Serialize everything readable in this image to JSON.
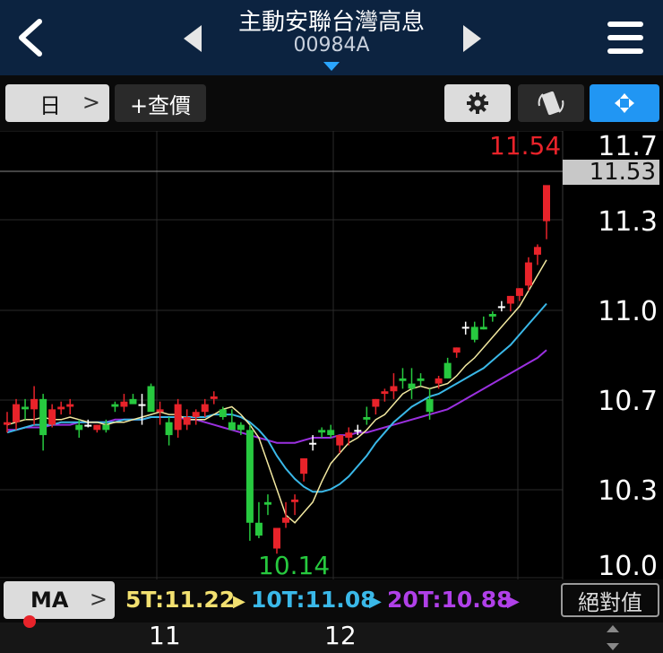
{
  "header": {
    "title": "主動安聯台灣高息",
    "code": "00984A",
    "colors": {
      "bg": "#0c2340",
      "accent": "#2aa6ff"
    }
  },
  "toolbar": {
    "period_label": "日",
    "quote_label": "+查價",
    "icons": [
      "chevron-right-icon",
      "gear-icon",
      "rotate-icon",
      "fullscreen-icon"
    ]
  },
  "chart": {
    "y_ticks": [
      "11.7",
      "11.53",
      "11.3",
      "11.0",
      "10.7",
      "10.3",
      "10.0"
    ],
    "current_price": "11.53",
    "high_label": "11.54",
    "low_label": "10.14",
    "x_ticks": [
      "11",
      "12"
    ]
  },
  "ma_bar": {
    "ma_label": "MA",
    "ma5": "5T:11.22",
    "ma10": "10T:11.08",
    "ma20": "20T:10.88",
    "abs_label": "絕對值"
  },
  "chart_data": {
    "type": "candlestick",
    "up_color": "#e8232a",
    "down_color": "#27c93f",
    "ylim": [
      10.0,
      11.74
    ],
    "candles": [
      [
        10.6,
        10.65,
        10.57,
        10.61
      ],
      [
        10.61,
        10.7,
        10.58,
        10.68
      ],
      [
        10.67,
        10.7,
        10.62,
        10.66
      ],
      [
        10.66,
        10.75,
        10.6,
        10.7
      ],
      [
        10.7,
        10.72,
        10.5,
        10.56
      ],
      [
        10.6,
        10.68,
        10.59,
        10.66
      ],
      [
        10.66,
        10.69,
        10.64,
        10.67
      ],
      [
        10.67,
        10.7,
        10.64,
        10.68
      ],
      [
        10.6,
        10.62,
        10.55,
        10.58
      ],
      [
        10.6,
        10.62,
        10.59,
        10.6
      ],
      [
        10.58,
        10.6,
        10.57,
        10.6
      ],
      [
        10.6,
        10.62,
        10.57,
        10.58
      ],
      [
        10.68,
        10.69,
        10.65,
        10.67
      ],
      [
        10.67,
        10.72,
        10.65,
        10.69
      ],
      [
        10.7,
        10.72,
        10.69,
        10.68
      ],
      [
        10.68,
        10.72,
        10.6,
        10.68
      ],
      [
        10.75,
        10.76,
        10.68,
        10.65
      ],
      [
        10.65,
        10.69,
        10.6,
        10.66
      ],
      [
        10.61,
        10.63,
        10.52,
        10.56
      ],
      [
        10.58,
        10.7,
        10.55,
        10.68
      ],
      [
        10.6,
        10.66,
        10.58,
        10.63
      ],
      [
        10.63,
        10.66,
        10.6,
        10.65
      ],
      [
        10.65,
        10.7,
        10.63,
        10.68
      ],
      [
        10.7,
        10.73,
        10.68,
        10.71
      ],
      [
        10.66,
        10.67,
        10.62,
        10.63
      ],
      [
        10.61,
        10.66,
        10.58,
        10.58
      ],
      [
        10.6,
        10.61,
        10.56,
        10.58
      ],
      [
        10.58,
        10.6,
        10.15,
        10.22
      ],
      [
        10.22,
        10.3,
        10.16,
        10.17
      ],
      [
        10.3,
        10.33,
        10.25,
        10.29
      ],
      [
        10.12,
        10.19,
        10.1,
        10.2
      ],
      [
        10.22,
        10.3,
        10.2,
        10.24
      ],
      [
        10.3,
        10.33,
        10.25,
        10.31
      ],
      [
        10.41,
        10.47,
        10.38,
        10.47
      ],
      [
        10.53,
        10.56,
        10.5,
        10.53
      ],
      [
        10.58,
        10.59,
        10.55,
        10.57
      ],
      [
        10.58,
        10.6,
        10.55,
        10.56
      ],
      [
        10.52,
        10.56,
        10.49,
        10.56
      ],
      [
        10.55,
        10.59,
        10.52,
        10.57
      ],
      [
        10.58,
        10.6,
        10.56,
        10.58
      ],
      [
        10.63,
        10.67,
        10.6,
        10.62
      ],
      [
        10.67,
        10.7,
        10.64,
        10.7
      ],
      [
        10.72,
        10.74,
        10.69,
        10.73
      ],
      [
        10.73,
        10.8,
        10.7,
        10.75
      ],
      [
        10.78,
        10.82,
        10.74,
        10.77
      ],
      [
        10.76,
        10.82,
        10.7,
        10.74
      ],
      [
        10.78,
        10.8,
        10.75,
        10.77
      ],
      [
        10.7,
        10.74,
        10.62,
        10.65
      ],
      [
        10.76,
        10.79,
        10.74,
        10.78
      ],
      [
        10.84,
        10.86,
        10.78,
        10.78
      ],
      [
        10.88,
        10.9,
        10.86,
        10.9
      ],
      [
        10.98,
        11.0,
        10.95,
        10.98
      ],
      [
        10.98,
        11.0,
        10.92,
        10.93
      ],
      [
        10.98,
        11.02,
        10.97,
        10.97
      ],
      [
        11.03,
        11.04,
        11.0,
        11.02
      ],
      [
        11.06,
        11.08,
        11.04,
        11.06
      ],
      [
        11.07,
        11.1,
        11.04,
        11.1
      ],
      [
        11.1,
        11.13,
        11.08,
        11.13
      ],
      [
        11.14,
        11.25,
        11.12,
        11.23
      ],
      [
        11.26,
        11.3,
        11.22,
        11.29
      ],
      [
        11.39,
        11.52,
        11.32,
        11.53
      ]
    ],
    "ma5": [
      10.6,
      10.61,
      10.62,
      10.62,
      10.63,
      10.62,
      10.62,
      10.63,
      10.62,
      10.61,
      10.61,
      10.6,
      10.61,
      10.61,
      10.62,
      10.63,
      10.64,
      10.65,
      10.64,
      10.64,
      10.62,
      10.62,
      10.62,
      10.64,
      10.66,
      10.67,
      10.64,
      10.6,
      10.55,
      10.45,
      10.35,
      10.25,
      10.22,
      10.26,
      10.3,
      10.38,
      10.45,
      10.49,
      10.53,
      10.55,
      10.58,
      10.62,
      10.64,
      10.68,
      10.72,
      10.74,
      10.75,
      10.74,
      10.75,
      10.76,
      10.79,
      10.83,
      10.86,
      10.9,
      10.94,
      10.98,
      11.02,
      11.06,
      11.12,
      11.18,
      11.24
    ],
    "ma10": [
      10.57,
      10.58,
      10.59,
      10.6,
      10.6,
      10.6,
      10.61,
      10.61,
      10.61,
      10.61,
      10.61,
      10.61,
      10.61,
      10.62,
      10.62,
      10.62,
      10.63,
      10.63,
      10.63,
      10.63,
      10.63,
      10.63,
      10.63,
      10.64,
      10.64,
      10.64,
      10.63,
      10.61,
      10.58,
      10.54,
      10.48,
      10.43,
      10.39,
      10.36,
      10.34,
      10.34,
      10.35,
      10.37,
      10.4,
      10.44,
      10.48,
      10.53,
      10.57,
      10.61,
      10.64,
      10.67,
      10.69,
      10.71,
      10.72,
      10.74,
      10.76,
      10.78,
      10.8,
      10.82,
      10.85,
      10.88,
      10.91,
      10.95,
      10.99,
      11.03,
      11.07
    ],
    "ma20": [
      10.58,
      10.58,
      10.59,
      10.59,
      10.59,
      10.6,
      10.6,
      10.6,
      10.61,
      10.61,
      10.61,
      10.61,
      10.62,
      10.62,
      10.62,
      10.62,
      10.63,
      10.63,
      10.63,
      10.63,
      10.62,
      10.62,
      10.61,
      10.6,
      10.59,
      10.58,
      10.57,
      10.56,
      10.55,
      10.54,
      10.53,
      10.53,
      10.53,
      10.54,
      10.55,
      10.55,
      10.55,
      10.56,
      10.56,
      10.57,
      10.57,
      10.58,
      10.59,
      10.6,
      10.61,
      10.62,
      10.63,
      10.64,
      10.65,
      10.66,
      10.68,
      10.7,
      10.72,
      10.74,
      10.76,
      10.78,
      10.8,
      10.82,
      10.84,
      10.86,
      10.89
    ]
  }
}
